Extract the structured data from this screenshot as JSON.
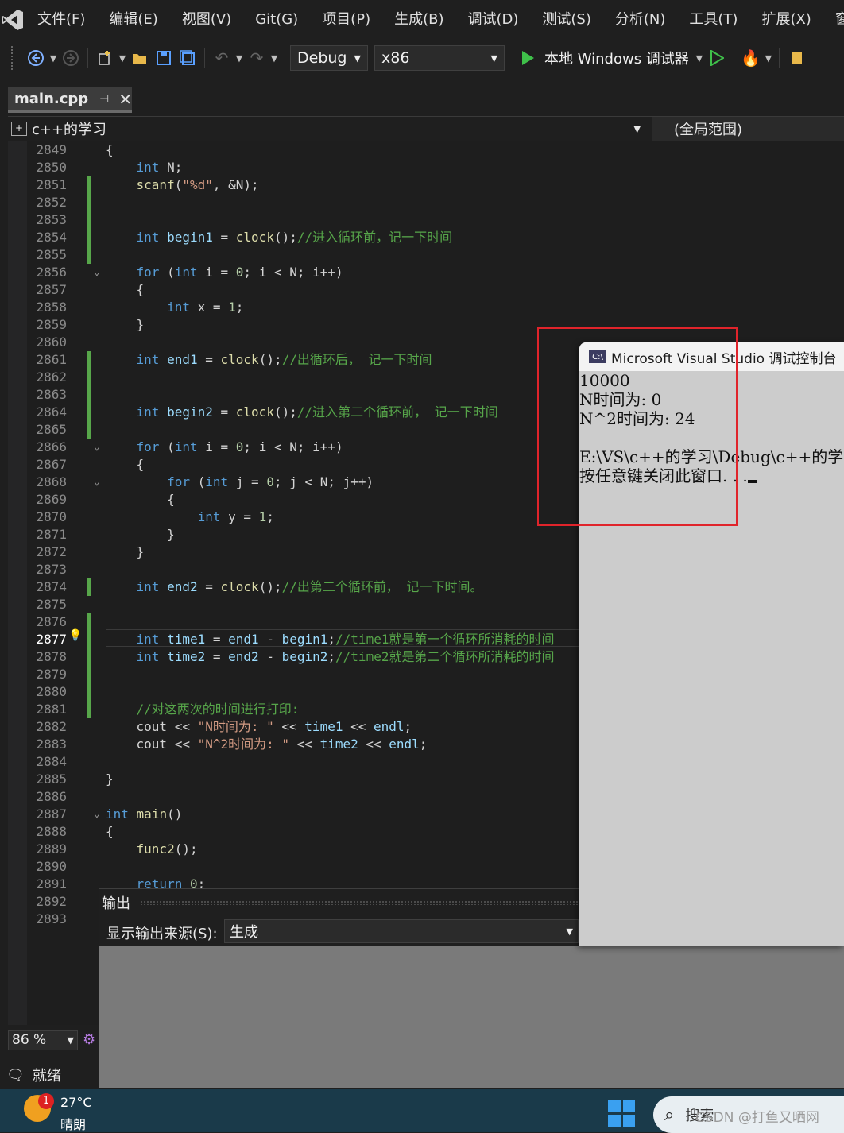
{
  "menu": {
    "items": [
      "文件(F)",
      "编辑(E)",
      "视图(V)",
      "Git(G)",
      "项目(P)",
      "生成(B)",
      "调试(D)",
      "测试(S)",
      "分析(N)",
      "工具(T)",
      "扩展(X)",
      "窗"
    ]
  },
  "toolbar": {
    "config": "Debug",
    "platform": "x86",
    "run_label": "本地 Windows 调试器"
  },
  "tab": {
    "title": "main.cpp"
  },
  "navbar": {
    "project": "c++的学习",
    "scope": "(全局范围)"
  },
  "editor": {
    "lines": [
      {
        "n": "2849",
        "t": "{"
      },
      {
        "n": "2850",
        "t": "    int N;"
      },
      {
        "n": "2851",
        "t": "    scanf(\"%d\", &N);"
      },
      {
        "n": "2852",
        "t": ""
      },
      {
        "n": "2853",
        "t": ""
      },
      {
        "n": "2854",
        "t": "    int begin1 = clock();//进入循环前，记一下时间"
      },
      {
        "n": "2855",
        "t": ""
      },
      {
        "n": "2856",
        "t": "    for (int i = 0; i < N; i++)"
      },
      {
        "n": "2857",
        "t": "    {"
      },
      {
        "n": "2858",
        "t": "        int x = 1;"
      },
      {
        "n": "2859",
        "t": "    }"
      },
      {
        "n": "2860",
        "t": ""
      },
      {
        "n": "2861",
        "t": "    int end1 = clock();//出循环后， 记一下时间"
      },
      {
        "n": "2862",
        "t": ""
      },
      {
        "n": "2863",
        "t": ""
      },
      {
        "n": "2864",
        "t": "    int begin2 = clock();//进入第二个循环前， 记一下时间"
      },
      {
        "n": "2865",
        "t": ""
      },
      {
        "n": "2866",
        "t": "    for (int i = 0; i < N; i++)"
      },
      {
        "n": "2867",
        "t": "    {"
      },
      {
        "n": "2868",
        "t": "        for (int j = 0; j < N; j++)"
      },
      {
        "n": "2869",
        "t": "        {"
      },
      {
        "n": "2870",
        "t": "            int y = 1;"
      },
      {
        "n": "2871",
        "t": "        }"
      },
      {
        "n": "2872",
        "t": "    }"
      },
      {
        "n": "2873",
        "t": ""
      },
      {
        "n": "2874",
        "t": "    int end2 = clock();//出第二个循环前， 记一下时间。"
      },
      {
        "n": "2875",
        "t": ""
      },
      {
        "n": "2876",
        "t": ""
      },
      {
        "n": "2877",
        "t": "    int time1 = end1 - begin1;//time1就是第一个循环所消耗的时间"
      },
      {
        "n": "2878",
        "t": "    int time2 = end2 - begin2;//time2就是第二个循环所消耗的时间"
      },
      {
        "n": "2879",
        "t": ""
      },
      {
        "n": "2880",
        "t": ""
      },
      {
        "n": "2881",
        "t": "    //对这两次的时间进行打印:"
      },
      {
        "n": "2882",
        "t": "    cout << \"N时间为: \" << time1 << endl;"
      },
      {
        "n": "2883",
        "t": "    cout << \"N^2时间为: \" << time2 << endl;"
      },
      {
        "n": "2884",
        "t": ""
      },
      {
        "n": "2885",
        "t": "}"
      },
      {
        "n": "2886",
        "t": ""
      },
      {
        "n": "2887",
        "t": "int main()"
      },
      {
        "n": "2888",
        "t": "{"
      },
      {
        "n": "2889",
        "t": "    func2();"
      },
      {
        "n": "2890",
        "t": ""
      },
      {
        "n": "2891",
        "t": "    return 0;"
      },
      {
        "n": "2892",
        "t": ""
      },
      {
        "n": "2893",
        "t": ""
      }
    ],
    "current_line": "2877"
  },
  "zoom": "86 %",
  "status": {
    "text": "就绪"
  },
  "output": {
    "title": "输出",
    "source_label": "显示输出来源(S):",
    "source_value": "生成"
  },
  "console": {
    "title": "Microsoft Visual Studio 调试控制台",
    "lines": [
      "10000",
      "N时间为: 0",
      "N^2时间为: 24",
      "",
      "E:\\VS\\c++的学习\\Debug\\c++的学",
      "按任意键关闭此窗口. . ."
    ]
  },
  "taskbar": {
    "weather_badge": "1",
    "temperature": "27°C",
    "weather": "晴朗",
    "search_label": "搜索"
  },
  "watermark": "CSDN @打鱼又晒网"
}
